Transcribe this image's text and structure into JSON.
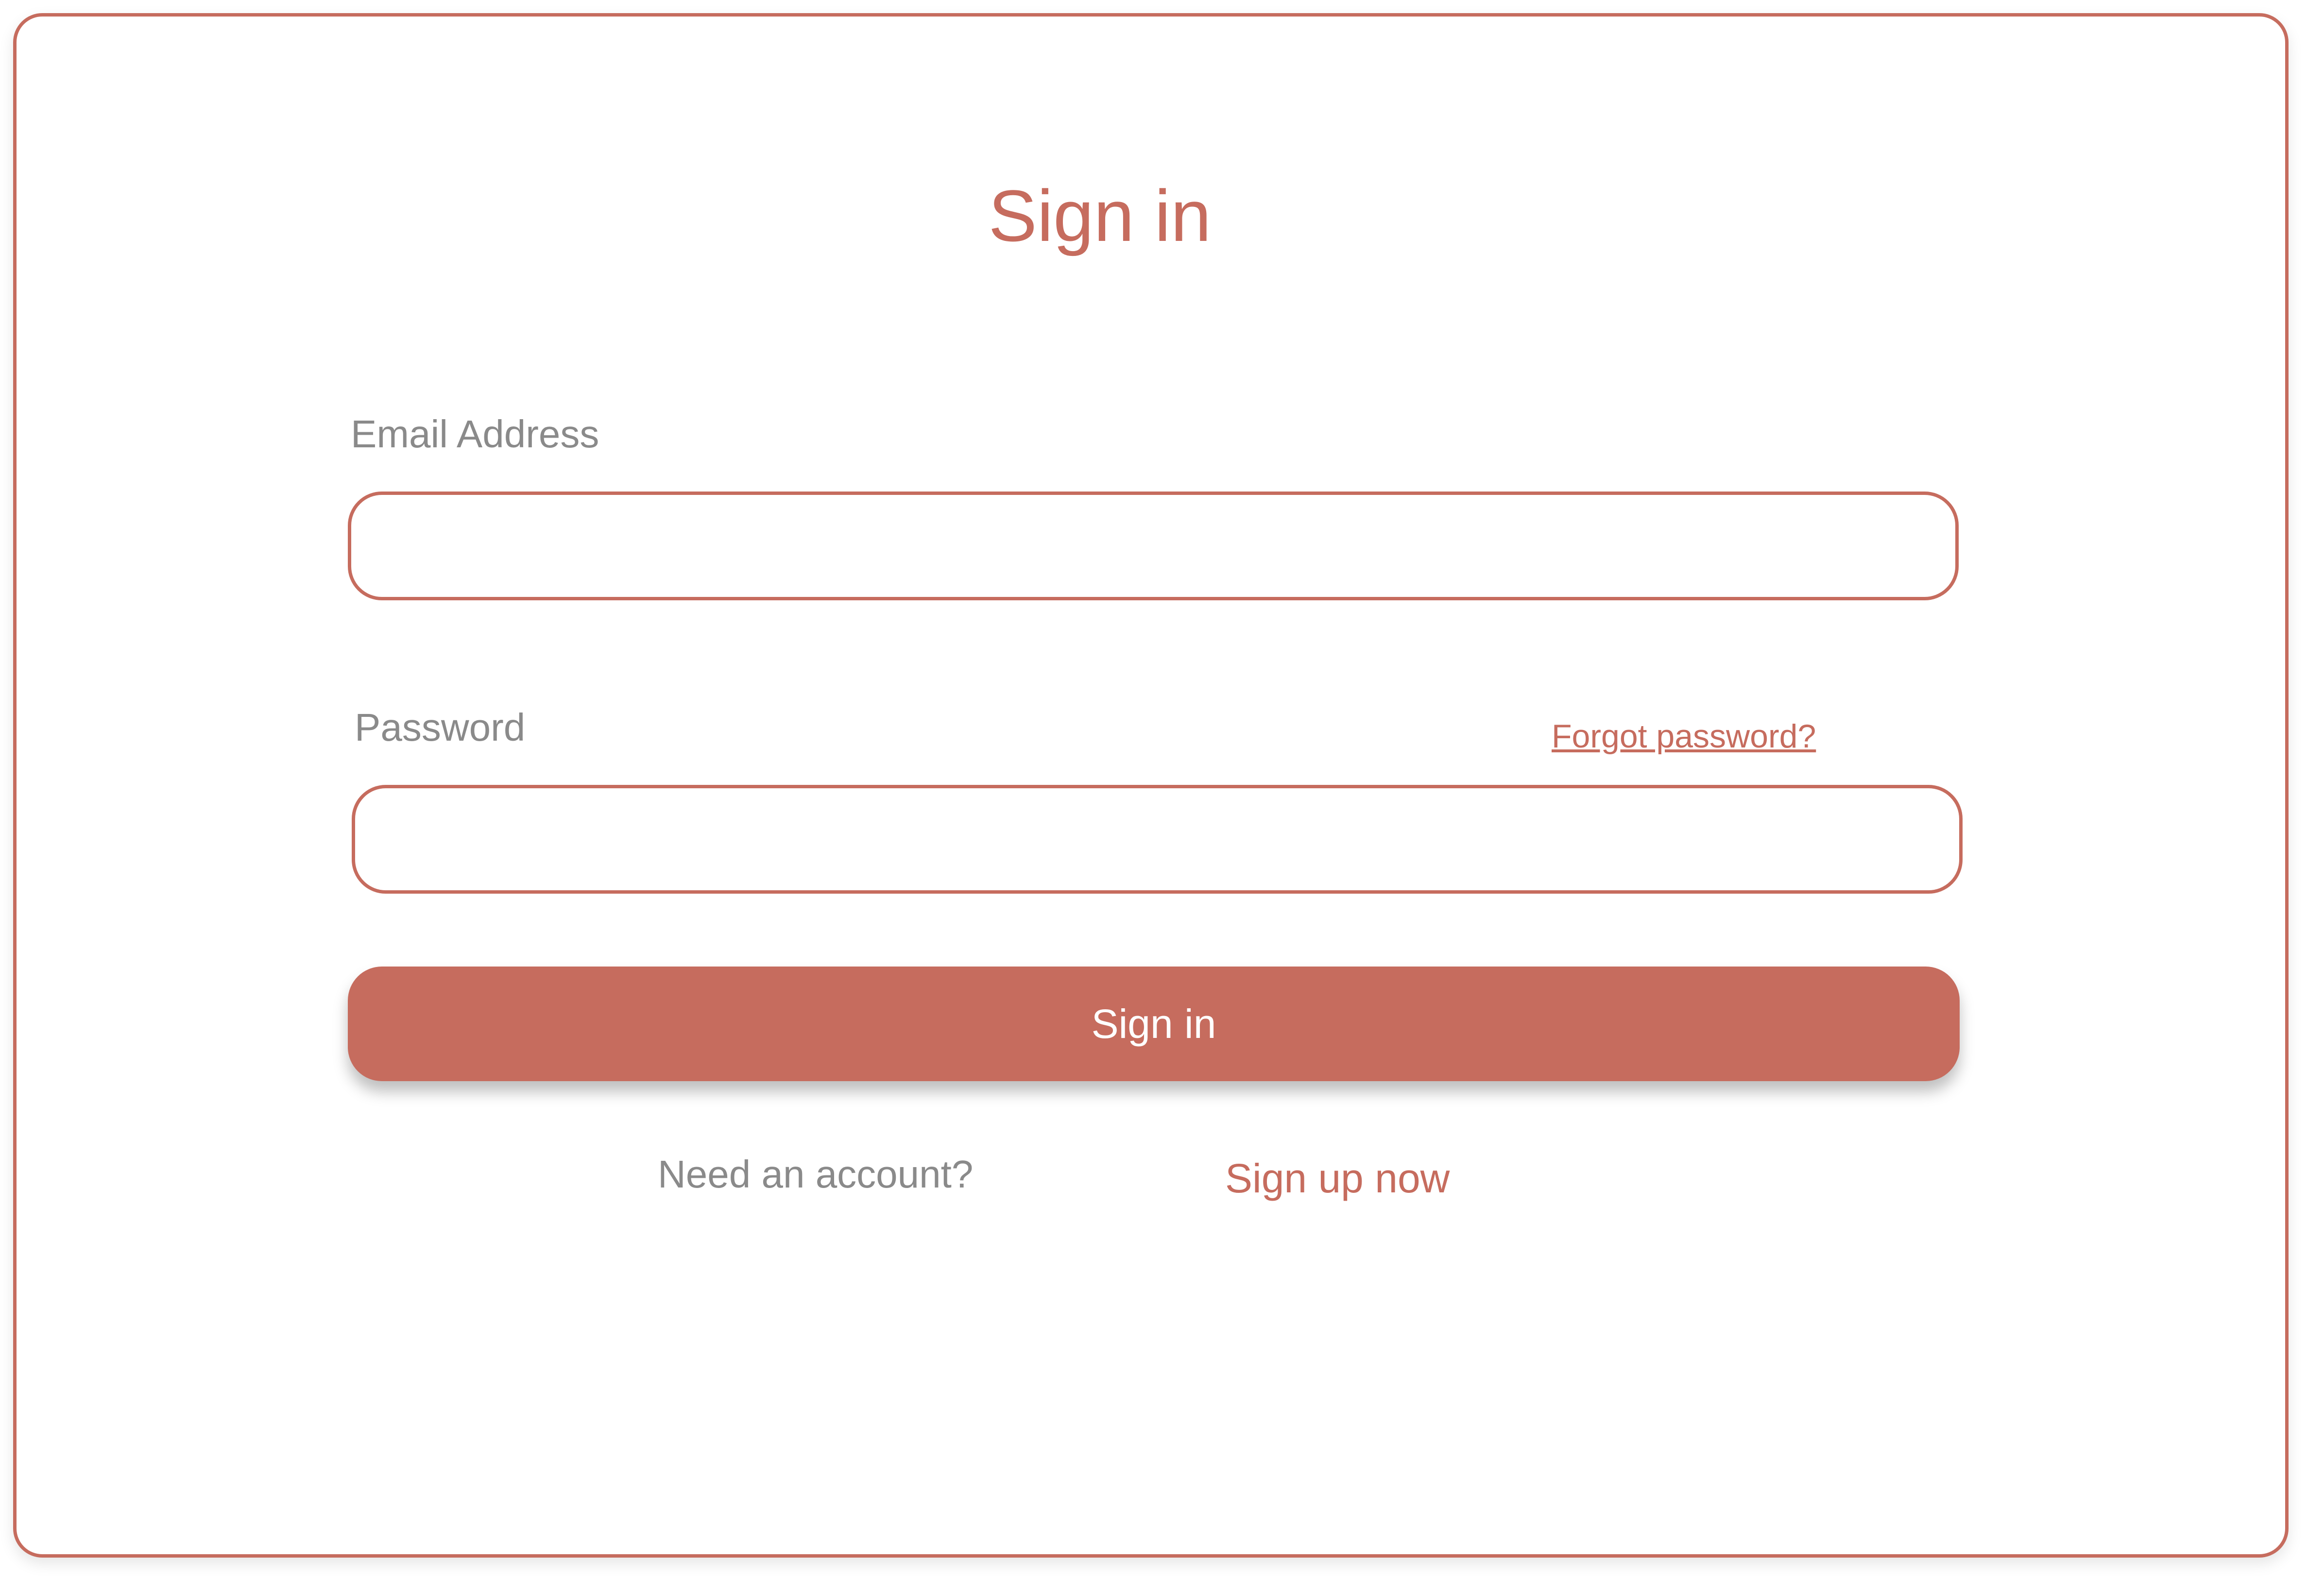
{
  "form": {
    "title": "Sign in",
    "email_label": "Email Address",
    "email_value": "",
    "email_placeholder": "",
    "password_label": "Password",
    "password_value": "",
    "password_placeholder": "",
    "forgot_password": "Forgot password?",
    "submit_label": "Sign in",
    "need_account": "Need an account?",
    "sign_up": "Sign up now"
  },
  "colors": {
    "accent": "#C66C5E",
    "muted_text": "#8A8A8A",
    "background": "#FFFFFF"
  }
}
